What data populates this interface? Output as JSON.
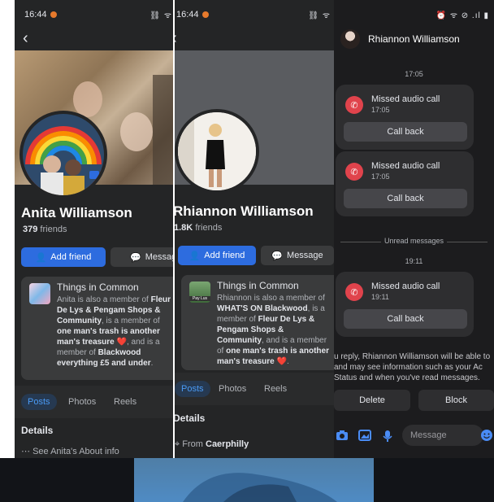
{
  "status_bar": {
    "time": "16:44",
    "icons_left": "⛓ ᯤ",
    "icons_right": "⏰ ᯤ ⊘ .ıl ▮"
  },
  "profile_anita": {
    "name": "Anita Williamson",
    "friends_count": "379",
    "friends_label": "friends",
    "add_friend": "Add friend",
    "message": "Message",
    "things_title": "Things in Common",
    "things_parts": [
      "Anita is also a member of ",
      "Fleur De Lys & Pengam Shops & Community",
      ", is a member of ",
      "one man's trash is another man's treasure",
      " ❤️, and is a member of ",
      "Blackwood everything £5 and under",
      "."
    ],
    "tabs": [
      "Posts",
      "Photos",
      "Reels"
    ],
    "details_title": "Details",
    "details_line": "See Anita's About info"
  },
  "profile_rhiannon": {
    "name": "Rhiannon Williamson",
    "friends_count": "1.8K",
    "friends_label": "friends",
    "add_friend": "Add friend",
    "message": "Message",
    "things_title": "Things in Common",
    "thumb_label": "Pay Lus",
    "things_parts": [
      "Rhiannon is also a member of ",
      "WHAT'S ON Blackwood",
      ", is a member of ",
      "Fleur De Lys & Pengam Shops & Community",
      ", and is a member of ",
      "one man's trash is another man's treasure",
      " ❤️."
    ],
    "tabs": [
      "Posts",
      "Photos",
      "Reels"
    ],
    "details_title": "Details",
    "from_label": "From",
    "from_value": "Caerphilly"
  },
  "messenger": {
    "contact": "Rhiannon Williamson",
    "time1": "17:05",
    "calls": [
      {
        "label": "Missed audio call",
        "time": "17:05",
        "action": "Call back"
      },
      {
        "label": "Missed audio call",
        "time": "17:05",
        "action": "Call back"
      },
      {
        "label": "Missed audio call",
        "time": "19:11",
        "action": "Call back"
      }
    ],
    "unread": "Unread messages",
    "time2": "19:11",
    "info_lines": [
      "u reply, Rhiannon Williamson will be able to",
      "and may see information such as your Ac",
      "Status and when you've read messages."
    ],
    "delete": "Delete",
    "block": "Block",
    "input_placeholder": "Message"
  },
  "colors": {
    "primary_button": "#2d6cdf",
    "missed_call": "#e0434c",
    "panel_bg": "#242526"
  }
}
